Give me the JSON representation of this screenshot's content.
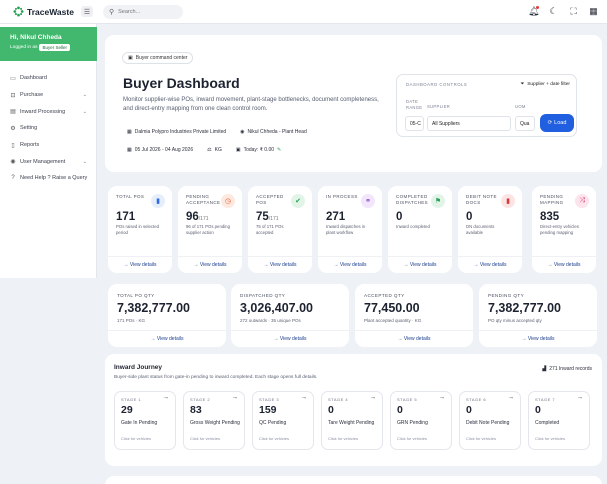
{
  "app": {
    "name": "TraceWaste"
  },
  "search": {
    "placeholder": "Search..."
  },
  "user": {
    "greeting": "Hi, Nikul Chheda",
    "logged_in_as": "Logged in as",
    "role": "Buyer Seller"
  },
  "nav": [
    {
      "icon": "monitor-icon",
      "label": "Dashboard",
      "chevron": false
    },
    {
      "icon": "cart-icon",
      "label": "Purchase",
      "chevron": true
    },
    {
      "icon": "inbox-icon",
      "label": "Inward Processing",
      "chevron": true
    },
    {
      "icon": "gear-icon",
      "label": "Setting",
      "chevron": false
    },
    {
      "icon": "document-icon",
      "label": "Reports",
      "chevron": false
    },
    {
      "icon": "user-icon",
      "label": "User Management",
      "chevron": true
    },
    {
      "icon": "help-icon",
      "label": "Need Help ? Raise a Query",
      "chevron": false
    }
  ],
  "header": {
    "badge": "Buyer command center",
    "title": "Buyer Dashboard",
    "description": "Monitor supplier-wise POs, inward movement, plant-stage bottlenecks, document completeness, and direct-entry mapping from one clean control room.",
    "company": "Dalmia Polypro Industries Private Limited",
    "person": "Nikul Chheda - Plant Head",
    "date_range": "05 Jul 2026 - 04 Aug 2026",
    "unit": "KG",
    "today": "Today: ₹ 0.00"
  },
  "controls": {
    "label": "DASHBOARD CONTROLS",
    "filter_button": "Supplier + date filter",
    "date_range_label": "DATE RANGE",
    "supplier_label": "SUPPLIER",
    "uom_label": "UOM",
    "date_value": "05-C",
    "supplier_value": "All Suppliers",
    "uom_value": "Qua",
    "load_button": "Load"
  },
  "kpis": [
    {
      "title": "TOTAL POS",
      "value": "171",
      "suffix": "",
      "sub": "POs raised in selected period",
      "link": "View details",
      "icon": "file-icon",
      "color": "#2f6ae0",
      "bg": "#e6eefc"
    },
    {
      "title": "PENDING ACCEPTANCE",
      "value": "96",
      "suffix": "/171",
      "sub": "96 of 171 POs pending supplier action",
      "link": "View details",
      "icon": "clock-icon",
      "color": "#e0632f",
      "bg": "#fde9df"
    },
    {
      "title": "ACCEPTED POS",
      "value": "75",
      "suffix": "/171",
      "sub": "75 of 171 POs accepted",
      "link": "View details",
      "icon": "check-icon",
      "color": "#2aa157",
      "bg": "#e2f4e8"
    },
    {
      "title": "IN PROCESS",
      "value": "271",
      "suffix": "",
      "sub": "Inward dispatches in plant workflow",
      "link": "View details",
      "icon": "flow-icon",
      "color": "#8a3fd1",
      "bg": "#f1e6fb"
    },
    {
      "title": "COMPLETED DISPATCHES",
      "value": "0",
      "suffix": "",
      "sub": "Inward completed",
      "link": "View details",
      "icon": "flag-icon",
      "color": "#2aa157",
      "bg": "#e2f4e8"
    },
    {
      "title": "DEBIT NOTE DOCS",
      "value": "0",
      "suffix": "",
      "sub": "DN documents available",
      "link": "View details",
      "icon": "doc-icon",
      "color": "#d63a3a",
      "bg": "#fce4e4"
    },
    {
      "title": "PENDING MAPPING",
      "value": "835",
      "suffix": "",
      "sub": "Direct-entry vehicles pending mapping",
      "link": "View details",
      "icon": "shuffle-icon",
      "color": "#d63a6a",
      "bg": "#fce4ec"
    }
  ],
  "qty_cards": [
    {
      "title": "TOTAL PO QTY",
      "value": "7,382,777.00",
      "sub": "171 POs · KG",
      "link": "View details"
    },
    {
      "title": "DISPATCHED QTY",
      "value": "3,026,407.00",
      "sub": "272 outwards · 35 unique POs",
      "link": "View details"
    },
    {
      "title": "ACCEPTED QTY",
      "value": "77,450.00",
      "sub": "Plant accepted quantity · KG",
      "link": "View details"
    },
    {
      "title": "PENDING QTY",
      "value": "7,382,777.00",
      "sub": "PO qty minus accepted qty",
      "link": "View details"
    }
  ],
  "journey": {
    "title": "Inward Journey",
    "description": "Buyer-side plant status from gate-in pending to inward completed. Each stage opens full details.",
    "records": "271 Inward records",
    "stages": [
      {
        "label": "STAGE 1",
        "value": "29",
        "name": "Gate In Pending",
        "cta": "Click for vehicles"
      },
      {
        "label": "STAGE 2",
        "value": "83",
        "name": "Gross Weight Pending",
        "cta": "Click for vehicles"
      },
      {
        "label": "STAGE 3",
        "value": "159",
        "name": "QC Pending",
        "cta": "Click for vehicles"
      },
      {
        "label": "STAGE 4",
        "value": "0",
        "name": "Tare Weight Pending",
        "cta": "Click for vehicles"
      },
      {
        "label": "STAGE 5",
        "value": "0",
        "name": "GRN Pending",
        "cta": "Click for vehicles"
      },
      {
        "label": "STAGE 6",
        "value": "0",
        "name": "Debit Note Pending",
        "cta": "Click for vehicles"
      },
      {
        "label": "STAGE 7",
        "value": "0",
        "name": "Completed",
        "cta": "Click for vehicles"
      }
    ]
  }
}
